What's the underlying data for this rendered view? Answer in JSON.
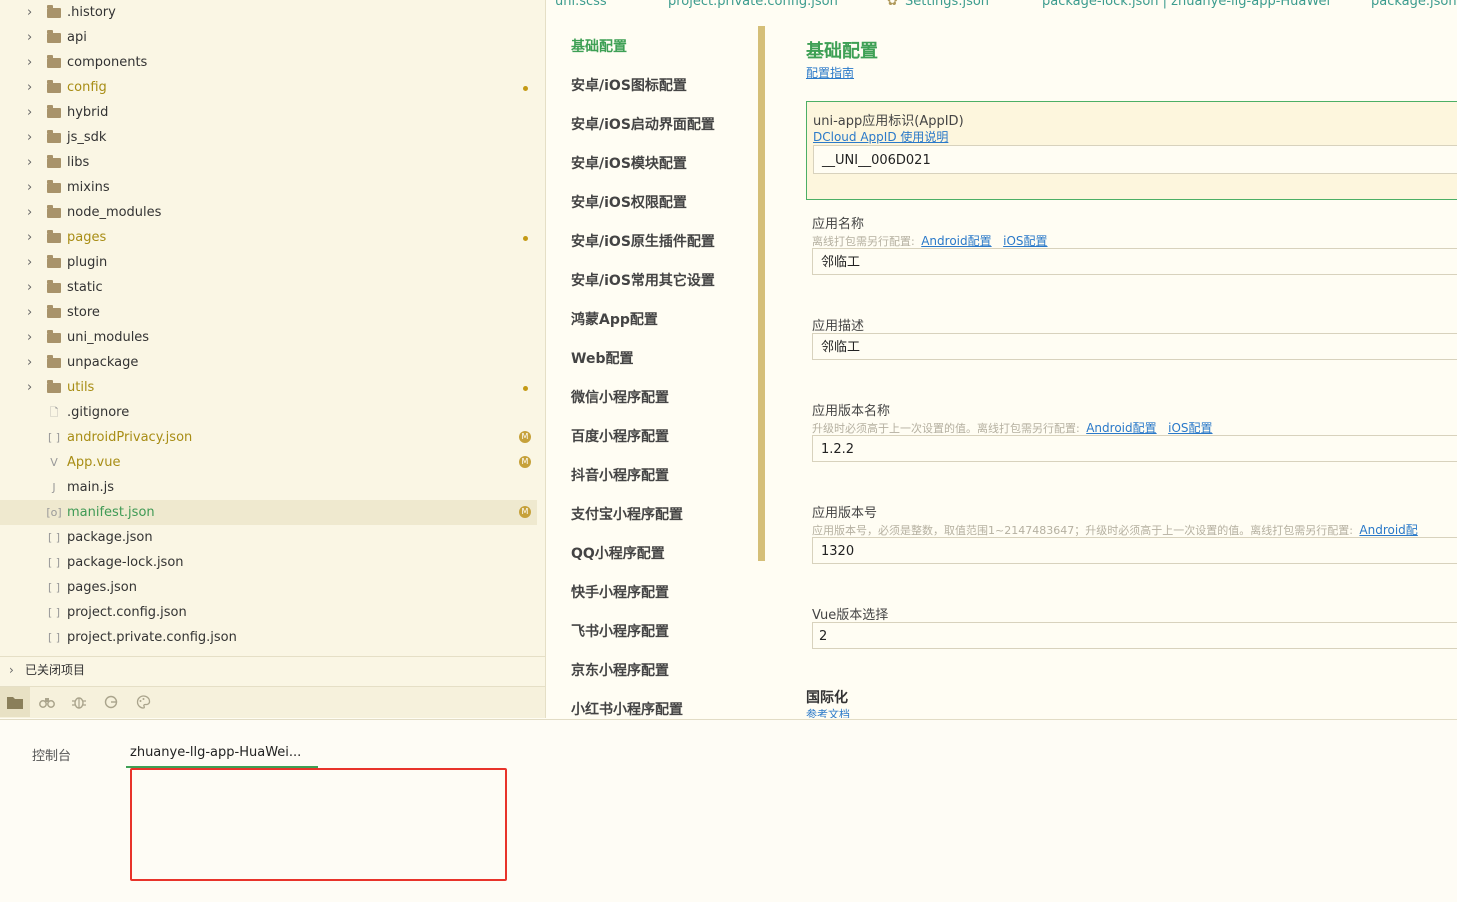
{
  "explorer": {
    "items": [
      {
        "label": ".history",
        "type": "folder",
        "status": ""
      },
      {
        "label": "api",
        "type": "folder",
        "status": ""
      },
      {
        "label": "components",
        "type": "folder",
        "status": ""
      },
      {
        "label": "config",
        "type": "folder",
        "status": "dot"
      },
      {
        "label": "hybrid",
        "type": "folder",
        "status": ""
      },
      {
        "label": "js_sdk",
        "type": "folder",
        "status": ""
      },
      {
        "label": "libs",
        "type": "folder",
        "status": ""
      },
      {
        "label": "mixins",
        "type": "folder",
        "status": ""
      },
      {
        "label": "node_modules",
        "type": "folder",
        "status": ""
      },
      {
        "label": "pages",
        "type": "folder",
        "status": "dot"
      },
      {
        "label": "plugin",
        "type": "folder",
        "status": ""
      },
      {
        "label": "static",
        "type": "folder",
        "status": ""
      },
      {
        "label": "store",
        "type": "folder",
        "status": ""
      },
      {
        "label": "uni_modules",
        "type": "folder",
        "status": ""
      },
      {
        "label": "unpackage",
        "type": "folder",
        "status": ""
      },
      {
        "label": "utils",
        "type": "folder",
        "status": "dot"
      },
      {
        "label": ".gitignore",
        "type": "file",
        "icon": "file-icon",
        "status": ""
      },
      {
        "label": "androidPrivacy.json",
        "type": "file",
        "icon": "json-file-icon",
        "status": "M"
      },
      {
        "label": "App.vue",
        "type": "file",
        "icon": "vue-file-icon",
        "status": "M"
      },
      {
        "label": "main.js",
        "type": "file",
        "icon": "js-file-icon",
        "status": ""
      },
      {
        "label": "manifest.json",
        "type": "file",
        "icon": "manifest-file-icon",
        "status": "M",
        "selected": true
      },
      {
        "label": "package.json",
        "type": "file",
        "icon": "json-file-icon",
        "status": ""
      },
      {
        "label": "package-lock.json",
        "type": "file",
        "icon": "json-file-icon",
        "status": ""
      },
      {
        "label": "pages.json",
        "type": "file",
        "icon": "json-file-icon",
        "status": ""
      },
      {
        "label": "project.config.json",
        "type": "file",
        "icon": "json-file-icon",
        "status": ""
      },
      {
        "label": "project.private.config.json",
        "type": "file",
        "icon": "json-file-icon",
        "status": ""
      }
    ],
    "closed_projects_label": "已关闭项目",
    "toolbar": [
      "project-explorer-icon",
      "binoculars-icon",
      "bug-icon",
      "git-icon",
      "palette-icon"
    ]
  },
  "editor_tabs": [
    "uni.scss",
    "project.private.config.json",
    "Settings.json",
    "package-lock.json | zhuanye-llg-app-HuaWei",
    "package.json"
  ],
  "manifest_nav": {
    "items": [
      "基础配置",
      "安卓/iOS图标配置",
      "安卓/iOS启动界面配置",
      "安卓/iOS模块配置",
      "安卓/iOS权限配置",
      "安卓/iOS原生插件配置",
      "安卓/iOS常用其它设置",
      "鸿蒙App配置",
      "Web配置",
      "微信小程序配置",
      "百度小程序配置",
      "抖音小程序配置",
      "支付宝小程序配置",
      "QQ小程序配置",
      "快手小程序配置",
      "飞书小程序配置",
      "京东小程序配置",
      "小红书小程序配置"
    ],
    "active_index": 0
  },
  "form": {
    "title": "基础配置",
    "guide_link": "配置指南",
    "appid": {
      "label": "uni-app应用标识(AppID)",
      "help_link": "DCloud AppID 使用说明",
      "value": "__UNI__006D021"
    },
    "app_name": {
      "label": "应用名称",
      "hint": "离线打包需另行配置:",
      "android_link": "Android配置",
      "ios_link": "iOS配置",
      "value": "邻临工"
    },
    "app_desc": {
      "label": "应用描述",
      "value": "邻临工"
    },
    "version_name": {
      "label": "应用版本名称",
      "hint": "升级时必须高于上一次设置的值。离线打包需另行配置:",
      "android_link": "Android配置",
      "ios_link": "iOS配置",
      "value": "1.2.2"
    },
    "version_code": {
      "label": "应用版本号",
      "hint": "应用版本号，必须是整数，取值范围1~2147483647；升级时必须高于上一次设置的值。离线打包需另行配置:",
      "android_link": "Android配",
      "value": "1320"
    },
    "vue_version": {
      "label": "Vue版本选择",
      "value": "2"
    },
    "i18n": {
      "title": "国际化",
      "link": "参考文档"
    }
  },
  "console": {
    "label": "控制台",
    "tab": "zhuanye-llg-app-HuaWei..."
  },
  "colors": {
    "accent_green": "#3ea055",
    "link_blue": "#2a79c9",
    "modified_gold": "#a88d15",
    "highlight_red": "#e8332a"
  }
}
